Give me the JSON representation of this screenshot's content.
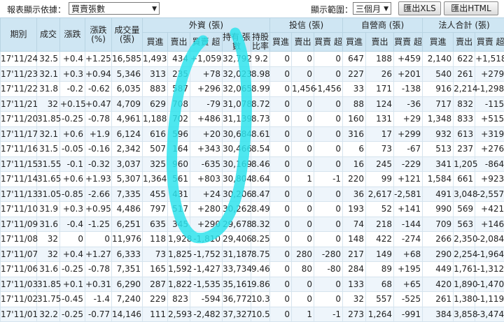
{
  "toolbar": {
    "label": "報表顯示依據：",
    "basis_select": "買賣張數",
    "range_label": "顯示範圍：",
    "range_select": "三個月",
    "export_xls": "匯出XLS",
    "export_html": "匯出HTML"
  },
  "headers": {
    "date": "期別",
    "close": "成交",
    "change": "漲跌",
    "change_pct": "漲跌 (%)",
    "volume": "成交量 (張)",
    "foreign": "外資 (張)",
    "trust": "投信 (張)",
    "dealer": "自營商 (張)",
    "total": "法人合計 (張)",
    "buy": "買進",
    "sell": "賣出",
    "net": "買賣 超",
    "hold": "持有 張數",
    "hold_ratio": "持股 比率"
  },
  "rows": [
    [
      "17'11/24",
      "32.5",
      "+0.4",
      "+1.25",
      "16,585",
      "1,493",
      "434",
      "+1,059",
      "32,792",
      "9.2",
      "0",
      "0",
      "0",
      "647",
      "188",
      "+459",
      "2,140",
      "622",
      "+1,518"
    ],
    [
      "17'11/23",
      "32.1",
      "+0.3",
      "+0.94",
      "5,346",
      "313",
      "235",
      "+78",
      "32,023",
      "8.98",
      "0",
      "0",
      "0",
      "227",
      "26",
      "+201",
      "540",
      "261",
      "+279"
    ],
    [
      "17'11/22",
      "31.8",
      "-0.2",
      "-0.62",
      "6,035",
      "883",
      "587",
      "+296",
      "32,065",
      "8.99",
      "0",
      "1,456",
      "-1,456",
      "33",
      "171",
      "-138",
      "916",
      "2,214",
      "-1,298"
    ],
    [
      "17'11/21",
      "32",
      "+0.15",
      "+0.47",
      "4,709",
      "629",
      "708",
      "-79",
      "31,078",
      "8.72",
      "0",
      "0",
      "0",
      "88",
      "124",
      "-36",
      "717",
      "832",
      "-115"
    ],
    [
      "17'11/20",
      "31.85",
      "-0.25",
      "-0.78",
      "4,961",
      "1,188",
      "702",
      "+486",
      "31,139",
      "8.73",
      "0",
      "0",
      "0",
      "160",
      "131",
      "+29",
      "1,348",
      "833",
      "+515"
    ],
    [
      "17'11/17",
      "32.1",
      "+0.6",
      "+1.9",
      "6,124",
      "616",
      "596",
      "+20",
      "30,684",
      "8.61",
      "0",
      "0",
      "0",
      "316",
      "17",
      "+299",
      "932",
      "613",
      "+319"
    ],
    [
      "17'11/16",
      "31.5",
      "-0.05",
      "-0.16",
      "2,342",
      "507",
      "164",
      "+343",
      "30,466",
      "8.54",
      "0",
      "0",
      "0",
      "6",
      "73",
      "-67",
      "513",
      "237",
      "+276"
    ],
    [
      "17'11/15",
      "31.55",
      "-0.1",
      "-0.32",
      "3,037",
      "325",
      "960",
      "-635",
      "30,169",
      "8.46",
      "0",
      "0",
      "0",
      "16",
      "245",
      "-229",
      "341",
      "1,205",
      "-864"
    ],
    [
      "17'11/14",
      "31.65",
      "+0.6",
      "+1.93",
      "5,307",
      "1,364",
      "561",
      "+803",
      "30,804",
      "8.64",
      "0",
      "1",
      "-1",
      "220",
      "99",
      "+121",
      "1,584",
      "661",
      "+923"
    ],
    [
      "17'11/13",
      "31.05",
      "-0.85",
      "-2.66",
      "7,335",
      "455",
      "431",
      "+24",
      "30,206",
      "8.47",
      "0",
      "0",
      "0",
      "36",
      "2,617",
      "-2,581",
      "491",
      "3,048",
      "-2,557"
    ],
    [
      "17'11/10",
      "31.9",
      "+0.3",
      "+0.95",
      "4,486",
      "797",
      "517",
      "+280",
      "30,262",
      "8.49",
      "0",
      "0",
      "0",
      "193",
      "52",
      "+141",
      "990",
      "569",
      "+421"
    ],
    [
      "17'11/09",
      "31.6",
      "-0.4",
      "-1.25",
      "6,251",
      "635",
      "345",
      "+290",
      "29,678",
      "8.32",
      "0",
      "0",
      "0",
      "74",
      "218",
      "-144",
      "709",
      "563",
      "+146"
    ],
    [
      "17'11/08",
      "32",
      "0",
      "0",
      "11,976",
      "118",
      "1,928",
      "-1,810",
      "29,406",
      "8.25",
      "0",
      "0",
      "0",
      "148",
      "422",
      "-274",
      "266",
      "2,350",
      "-2,084"
    ],
    [
      "17'11/07",
      "32",
      "+0.4",
      "+1.27",
      "6,333",
      "73",
      "1,825",
      "-1,752",
      "31,187",
      "8.75",
      "0",
      "280",
      "-280",
      "217",
      "149",
      "+68",
      "290",
      "2,254",
      "-1,964"
    ],
    [
      "17'11/06",
      "31.6",
      "-0.25",
      "-0.78",
      "7,351",
      "165",
      "1,592",
      "-1,427",
      "33,734",
      "9.46",
      "0",
      "80",
      "-80",
      "284",
      "89",
      "+195",
      "449",
      "1,761",
      "-1,312"
    ],
    [
      "17'11/03",
      "31.85",
      "+0.1",
      "+0.31",
      "6,290",
      "287",
      "1,822",
      "-1,535",
      "35,161",
      "9.86",
      "0",
      "0",
      "0",
      "133",
      "68",
      "+65",
      "420",
      "1,890",
      "-1,470"
    ],
    [
      "17'11/02",
      "31.75",
      "-0.45",
      "-1.4",
      "7,240",
      "229",
      "823",
      "-594",
      "36,772",
      "10.3",
      "0",
      "0",
      "0",
      "32",
      "557",
      "-525",
      "261",
      "1,380",
      "-1,119"
    ],
    [
      "17'11/01",
      "32.2",
      "-0.25",
      "-0.77",
      "14,146",
      "111",
      "2,593",
      "-2,482",
      "37,327",
      "10.5",
      "0",
      "1",
      "-1",
      "273",
      "1,264",
      "-991",
      "384",
      "3,858",
      "-3,474"
    ]
  ],
  "colors": {
    "header_bg": "#cfe6f3",
    "row_alt_bg": "#eef5fb",
    "positive": "#e8161c",
    "negative": "#0a9b2a",
    "highlight_stroke": "#2fe3ec"
  }
}
